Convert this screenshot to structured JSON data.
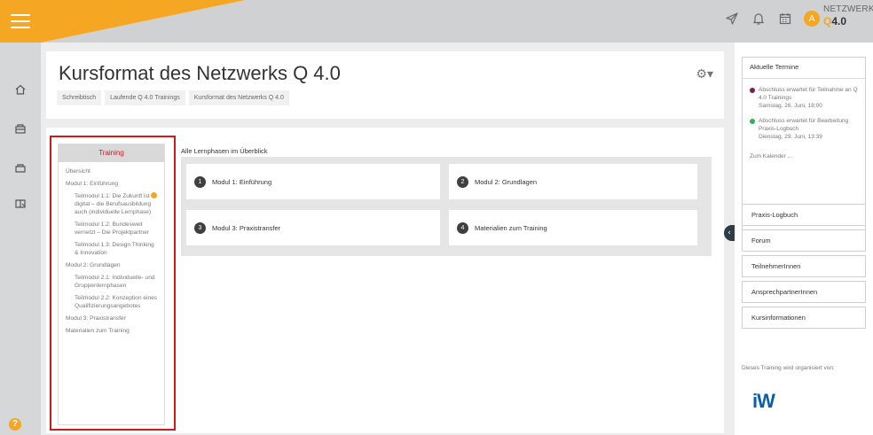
{
  "brand": {
    "line1": "NETZWERK",
    "q": "Q",
    "version": "4.0"
  },
  "user": {
    "avatar_initial": "A"
  },
  "colors": {
    "accent": "#f5a623",
    "highlight": "#d0191b",
    "logo": "#0b5ea8"
  },
  "header": {
    "title": "Kursformat des Netzwerks Q 4.0",
    "breadcrumb": [
      "Schreibtisch",
      "Laufende Q 4.0 Trainings",
      "Kursformat des Netzwerks Q 4.0"
    ]
  },
  "training_nav": {
    "heading": "Training",
    "items": [
      {
        "label": "Übersicht"
      },
      {
        "label": "Modul 1: Einführung"
      },
      {
        "label": "Teilmodul 1.1: Die Zukunft ist digital – die Berufsausbildung auch (individuelle Lernphase)"
      },
      {
        "label": "Teilmodul 1.2: Bundesweit vernetzt – Die Projektpartner"
      },
      {
        "label": "Teilmodul 1.3: Design Thinking & Innovation"
      },
      {
        "label": "Modul 2: Grundlagen"
      },
      {
        "label": "Teilmodul 2.1: Individuelle- und Gruppenlernphasen"
      },
      {
        "label": "Teilmodul 2.2: Konzeption eines Qualifizierungsangebotes"
      },
      {
        "label": "Modul 3: Praxistransfer"
      },
      {
        "label": "Materialien zum Training"
      }
    ]
  },
  "phases": {
    "title": "Alle Lernphasen im Überblick",
    "items": [
      {
        "num": "1",
        "label": "Modul 1: Einführung"
      },
      {
        "num": "2",
        "label": "Modul 2: Grundlagen"
      },
      {
        "num": "3",
        "label": "Modul 3: Praxistransfer"
      },
      {
        "num": "4",
        "label": "Materialien zum Training"
      }
    ]
  },
  "events": {
    "title": "Aktuelle Termine",
    "items": [
      {
        "text": "Abschluss erwartet für Teilnahme an Q 4.0 Trainings",
        "date": "Samstag, 26. Juni, 18:00",
        "color": "#7b1f4b"
      },
      {
        "text": "Abschluss erwartet für Bearbeitung Praxis-Logbuch",
        "date": "Dienstag, 29. Juni, 13:39",
        "color": "#2fb35a"
      }
    ],
    "calendar_link": "Zum Kalender ..."
  },
  "right_links": [
    "Praxis-Logbuch",
    "Forum",
    "TeilnehmerInnen",
    "AnsprechpartnerInnen",
    "Kursinformationen"
  ],
  "organizer": {
    "text": "Dieses Training wird organisiert von:",
    "logo": "iW"
  },
  "help": {
    "label": "?"
  }
}
